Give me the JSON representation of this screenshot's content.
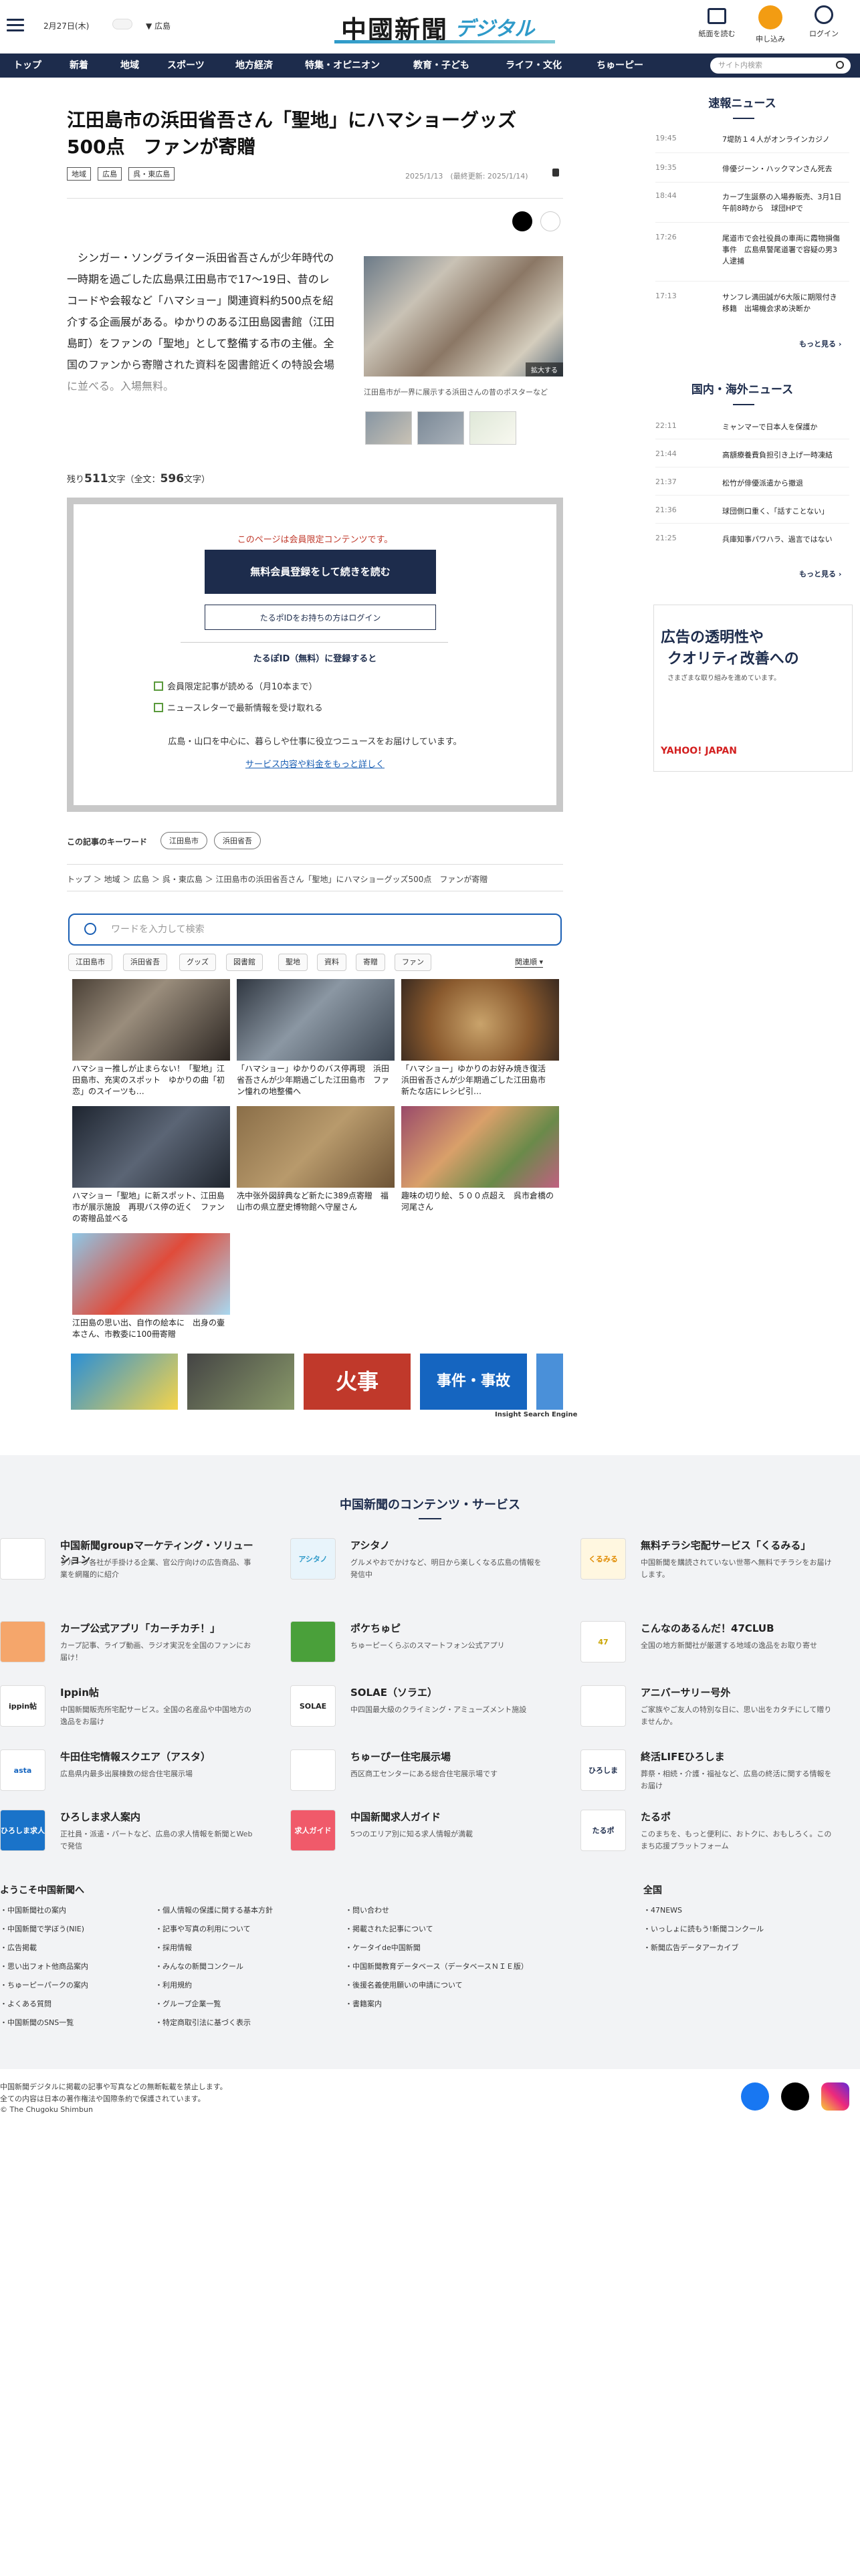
{
  "header": {
    "date": "2月27日(木)",
    "region": "広島",
    "logo_main": "中國新聞",
    "logo_sub": "デジタル",
    "icons": [
      {
        "label": "紙面を読む",
        "icon": "newspaper-icon"
      },
      {
        "label": "申し込み",
        "icon": "apply-icon"
      },
      {
        "label": "ログイン",
        "icon": "login-icon"
      }
    ]
  },
  "nav": {
    "items": [
      "トップ",
      "新着",
      "地域",
      "スポーツ",
      "地方経済",
      "特集・オピニオン",
      "教育・子ども",
      "ライフ・文化",
      "ちゅーピー"
    ],
    "search_placeholder": "サイト内検索"
  },
  "article": {
    "title": "江田島市の浜田省吾さん「聖地」にハマショーグッズ500点　ファンが寄贈",
    "tags": [
      "地域",
      "広島",
      "呉・東広島"
    ],
    "date": "2025/1/13　(最終更新: 2025/1/14)",
    "body": "シンガー・ソングライター浜田省吾さんが少年時代の一時期を過ごした広島県江田島市で17～19日、昔のレコードや会報など「ハマショー」関連資料約500点を紹介する企画展がある。ゆかりのある江田島図書館（江田島町）をファンの「聖地」として整備する市の主催。全国のファンから寄贈された資料を図書館近くの特設会場に並べる。入場無料。",
    "photo_enlarge": "拡大する",
    "photo_caption": "江田島市が一界に展示する浜田さんの昔のポスターなど",
    "remain_label": "残り",
    "remain_count": "511",
    "remain_unit": "文字",
    "total_label": "（全文：",
    "total_count": "596",
    "total_unit": "文字）"
  },
  "paywall": {
    "notice": "このページは会員限定コンテンツです。",
    "register_button": "無料会員登録をして続きを読む",
    "login_button": "たるポIDをお持ちの方はログイン",
    "register_heading": "たるぽID（無料）に登録すると",
    "benefits": [
      "会員限定記事が読める（月10本まで）",
      "ニュースレターで最新情報を受け取れる"
    ],
    "description": "広島・山口を中心に、暮らしや仕事に役立つニュースをお届けしています。",
    "more_link": "サービス内容や料金をもっと詳しく"
  },
  "keywords": {
    "label": "この記事のキーワード",
    "items": [
      "江田島市",
      "浜田省吾"
    ]
  },
  "breadcrumb": "トップ ＞ 地域 ＞ 広島 ＞ 呉・東広島 ＞ 江田島市の浜田省吾さん「聖地」にハマショーグッズ500点　ファンが寄贈",
  "related": {
    "search_placeholder": "ワードを入力して検索",
    "chips": [
      "江田島市",
      "浜田省吾",
      "グッズ",
      "図書館",
      "聖地",
      "資料",
      "寄贈",
      "ファン"
    ],
    "sort": "関連順",
    "cards": [
      "ハマショー推しが止まらない！「聖地」江田島市、充実のスポット　ゆかりの曲「初恋」のスイーツも…",
      "「ハマショー」ゆかりのバス停再現　浜田省吾さんが少年期過ごした江田島市　ファン憧れの地整備へ",
      "「ハマショー」ゆかりのお好み焼き復活　浜田省吾さんが少年期過ごした江田島市　新たな店にレシピ引…",
      "ハマショー「聖地」に新スポット、江田島市が展示施設　再現バス停の近く　ファンの寄贈品並べる",
      "冼中张外図辞典など新たに389点寄贈　福山市の県立歴史博物館へ守屋さん",
      "趣味の切り絵、５００点超え　呉市倉橋の河尾さん",
      "江田島の思い出、自作の絵本に　出身の壷本さん、市教委に100冊寄贈"
    ],
    "banners": [
      "",
      "",
      "火事",
      "事件・事故",
      ""
    ],
    "credit": "Insight Search Engine"
  },
  "sidebar": {
    "news_heading": "速報ニュース",
    "news": [
      {
        "time": "19:45",
        "title": "7堤防１４人がオンラインカジノ"
      },
      {
        "time": "19:35",
        "title": "俳優ジーン・ハックマンさん死去"
      },
      {
        "time": "18:44",
        "title": "カープ生誕祭の入場券販売、3月1日午前8時から　球団HPで"
      },
      {
        "time": "17:26",
        "title": "尾道市で会社役員の車両に霞物損傷事件　広島県警尾道署で容疑の男3人逮捕"
      },
      {
        "time": "17:13",
        "title": "サンフレ満田誠が6大阪に期限付き移籍　出場機会求め決断か"
      }
    ],
    "more1": "もっと見る",
    "intl_heading": "国内・海外ニュース",
    "intl": [
      {
        "time": "22:11",
        "title": "ミャンマーで日本人を保護か"
      },
      {
        "time": "21:44",
        "title": "高額療養費負担引き上げ一時凍結"
      },
      {
        "time": "21:37",
        "title": "松竹が俳優派遣から撤退"
      },
      {
        "time": "21:36",
        "title": "球団側口重く、「話すことない」"
      },
      {
        "time": "21:25",
        "title": "兵庫知事パワハラ、過言ではない"
      }
    ],
    "more2": "もっと見る",
    "ad_line1": "広告の透明性や",
    "ad_line2": "クオリティ改善への",
    "ad_line3": "さまざまな取り組みを進めています。",
    "ad_brand": "YAHOO! JAPAN"
  },
  "services": {
    "heading": "中国新聞のコンテンツ・サービス",
    "items": [
      {
        "name": "中国新聞groupマーケティング・ソリューション",
        "desc": "グループ各社が手掛ける企業、官公庁向けの広告商品、事業を網羅的に紹介"
      },
      {
        "name": "アシタノ",
        "desc": "グルメやおでかけなど、明日から楽しくなる広島の情報を発信中"
      },
      {
        "name": "無料チラシ宅配サービス「くるみる」",
        "desc": "中国新聞を購読されていない世帯へ無料でチラシをお届けします。"
      },
      {
        "name": "カープ公式アプリ「カーチカチ！」",
        "desc": "カープ記事、ライブ動画、ラジオ実況を全国のファンにお届け！"
      },
      {
        "name": "ポケちゅピ",
        "desc": "ちゅーピーくらぶのスマートフォン公式アプリ"
      },
      {
        "name": "こんなのあるんだ！47CLUB",
        "desc": "全国の地方新聞社が厳選する地域の逸品をお取り寄せ"
      },
      {
        "name": "Ippin帖",
        "desc": "中国新聞販売所宅配サービス。全国の名産品や中国地方の逸品をお届け"
      },
      {
        "name": "SOLAE（ソラエ）",
        "desc": "中四国最大級のクライミング・アミューズメント施設"
      },
      {
        "name": "アニバーサリー号外",
        "desc": "ご家族やご友人の特別な日に、思い出をカタチにして贈りませんか。"
      },
      {
        "name": "牛田住宅情報スクエア（アスタ）",
        "desc": "広島県内最多出展棟数の総合住宅展示場"
      },
      {
        "name": "ちゅーぴー住宅展示場",
        "desc": "西区商工センターにある総合住宅展示場です"
      },
      {
        "name": "終活LIFEひろしま",
        "desc": "葬祭・相続・介護・福祉など、広島の終活に関する情報をお届け"
      },
      {
        "name": "ひろしま求人案内",
        "desc": "正社員・派遣・パートなど、広島の求人情報を新聞とWebで発信"
      },
      {
        "name": "中国新聞求人ガイド",
        "desc": "5つのエリア別に知る求人情報が満載"
      },
      {
        "name": "たるポ",
        "desc": "このまちを、もっと便利に、おトクに、おもしろく。このまち応援プラットフォーム"
      }
    ],
    "logo_texts": [
      "",
      "アシタノ",
      "くるみる",
      "",
      "",
      "47",
      "ippin帖",
      "SOLAE",
      "",
      "asta",
      "",
      "ひろしま",
      "ひろしま求人案内",
      "求人ガイド",
      "たるポ"
    ]
  },
  "footer": {
    "welcome_heading": "ようこそ中国新聞へ",
    "col1": [
      "中国新聞社の案内",
      "中国新聞で学ぼう(NIE)",
      "広告掲載",
      "思い出フォト他商品案内",
      "ちゅーピーパークの案内",
      "よくある質問",
      "中国新聞のSNS一覧"
    ],
    "col2": [
      "個人情報の保護に関する基本方針",
      "記事や写真の利用について",
      "採用情報",
      "みんなの新聞コンクール",
      "利用規約",
      "グループ企業一覧",
      "特定商取引法に基づく表示"
    ],
    "col3": [
      "問い合わせ",
      "掲載された記事について",
      "ケータイde中国新聞",
      "中国新聞教育データベース（データベースＮＩＥ版）",
      "後援名義使用願いの申請について",
      "書籍案内"
    ],
    "national_heading": "全国",
    "col4": [
      "47NEWS",
      "いっしょに読もう!新聞コンクール",
      "新聞広告データアーカイブ"
    ],
    "copy1": "中国新聞デジタルに掲載の記事や写真などの無断転載を禁止します。",
    "copy2": "全ての内容は日本の著作権法や国際条約で保護されています。",
    "copy3": "© The Chugoku Shimbun",
    "sns": [
      "facebook-icon",
      "x-icon",
      "instagram-icon"
    ]
  }
}
